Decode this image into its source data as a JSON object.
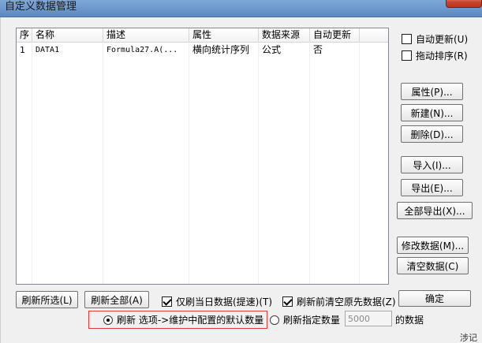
{
  "window": {
    "title": "自定义数据管理"
  },
  "table": {
    "columns": [
      "序",
      "名称",
      "描述",
      "属性",
      "数据来源",
      "自动更新"
    ],
    "rows": [
      [
        "1",
        "DATA1",
        "Formula27.A(...",
        "横向统计序列",
        "公式",
        "否"
      ]
    ]
  },
  "side": {
    "auto_update_label": "自动更新(U)",
    "auto_update_checked": false,
    "drag_sort_label": "拖动排序(R)",
    "drag_sort_checked": false,
    "properties_label": "属性(P)...",
    "new_label": "新建(N)...",
    "delete_label": "删除(D)...",
    "import_label": "导入(I)...",
    "export_label": "导出(E)...",
    "export_all_label": "全部导出(X)...",
    "modify_label": "修改数据(M)...",
    "clear_label": "清空数据(C)"
  },
  "bottom": {
    "refresh_selected_label": "刷新所选(L)",
    "refresh_all_label": "刷新全部(A)",
    "today_only_label": "仅刷当日数据(提速)(T)",
    "today_only_checked": true,
    "clear_before_label": "刷新前清空原先数据(Z)",
    "clear_before_checked": true,
    "ok_label": "确定",
    "radio_default_label": "刷新 选项->维护中配置的默认数量",
    "radio_default_selected": true,
    "radio_custom_label": "刷新指定数量",
    "radio_custom_selected": false,
    "count_value": "5000",
    "count_suffix": "的数据"
  },
  "edge_text": "涉记号"
}
